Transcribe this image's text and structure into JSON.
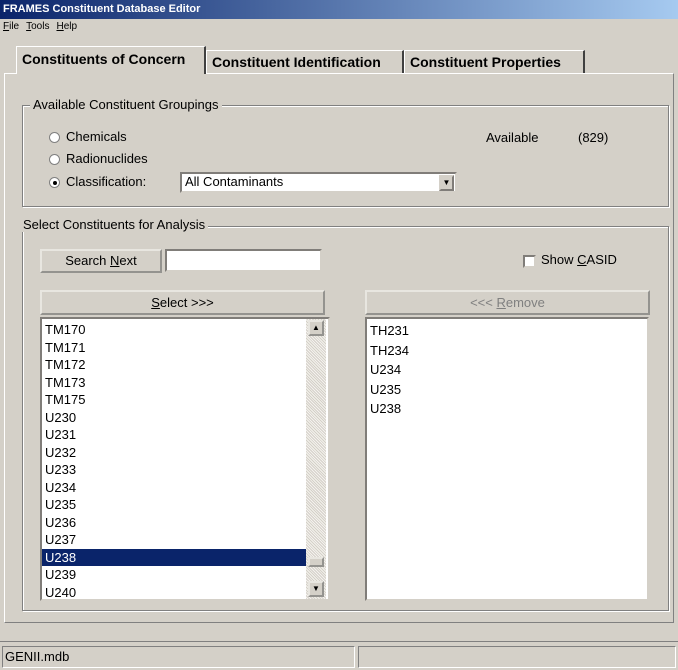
{
  "window": {
    "title": "FRAMES Constituent Database Editor"
  },
  "menu": {
    "file": "File",
    "tools": "Tools",
    "help": "Help"
  },
  "tabs": [
    {
      "label": "Constituents of Concern",
      "active": true
    },
    {
      "label": "Constituent Identification",
      "active": false
    },
    {
      "label": "Constituent Properties",
      "active": false
    }
  ],
  "groupings": {
    "legend": "Available Constituent Groupings",
    "chemicals_label": "Chemicals",
    "radionuclides_label": "Radionuclides",
    "classification_label": "Classification:",
    "selected_option": "Classification",
    "classification_value": "All Contaminants",
    "available_label": "Available",
    "available_count": "(829)"
  },
  "analysis": {
    "legend": "Select Constituents for Analysis",
    "search_next_label": "Search Next",
    "search_value": "",
    "show_casid_label": "Show CASID",
    "show_casid_checked": false,
    "select_button_label": "Select >>>",
    "remove_button_label": "<<< Remove",
    "available_list": [
      "TM170",
      "TM171",
      "TM172",
      "TM173",
      "TM175",
      "U230",
      "U231",
      "U232",
      "U233",
      "U234",
      "U235",
      "U236",
      "U237",
      "U238",
      "U239",
      "U240"
    ],
    "selected_item": "U238",
    "selected_list": [
      "TH231",
      "TH234",
      "U234",
      "U235",
      "U238"
    ]
  },
  "status": {
    "file": "GENII.mdb",
    "panel2": ""
  }
}
